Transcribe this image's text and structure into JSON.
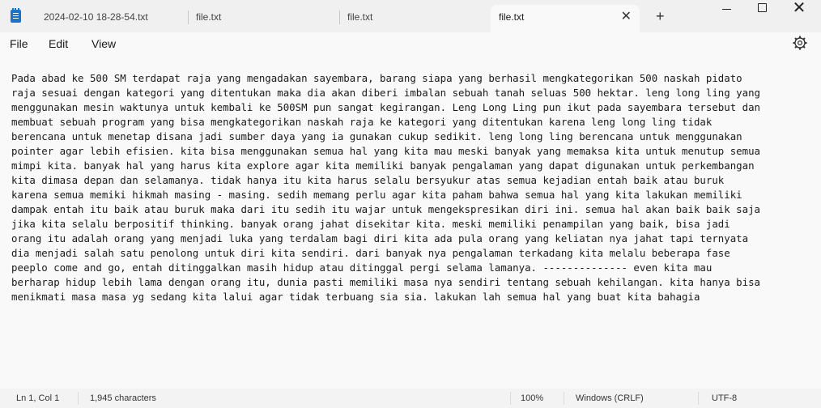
{
  "tabs": [
    {
      "label": "2024-02-10 18-28-54.txt"
    },
    {
      "label": "file.txt"
    },
    {
      "label": "file.txt"
    },
    {
      "label": "file.txt",
      "active": true
    }
  ],
  "window_controls": {
    "close_glyph": "✕",
    "new_tab_glyph": "+"
  },
  "menu": {
    "file": "File",
    "edit": "Edit",
    "view": "View"
  },
  "document": {
    "lines": [
      "Pada abad ke 500 SM terdapat raja yang mengadakan sayembara, barang siapa yang berhasil mengkategorikan 500 naskah pidato",
      "raja sesuai dengan kategori yang ditentukan maka dia akan diberi imbalan sebuah tanah seluas 500 hektar. leng long ling yang",
      "menggunakan mesin waktunya untuk kembali ke 500SM pun sangat kegirangan. Leng Long Ling pun ikut pada sayembara tersebut dan",
      "membuat sebuah program yang bisa mengkategorikan naskah raja ke kategori yang ditentukan karena leng long ling tidak",
      "berencana untuk menetap disana jadi sumber daya yang ia gunakan cukup sedikit. leng long ling berencana untuk menggunakan",
      "pointer agar lebih efisien. kita bisa menggunakan semua hal yang kita mau meski banyak yang memaksa kita untuk menutup semua",
      "mimpi kita. banyak hal yang harus kita explore agar kita memiliki banyak pengalaman yang dapat digunakan untuk perkembangan",
      "kita dimasa depan dan selamanya. tidak hanya itu kita harus selalu bersyukur atas semua kejadian entah baik atau buruk",
      "karena semua memiki hikmah masing - masing. sedih memang perlu agar kita paham bahwa semua hal yang kita lakukan memiliki",
      "dampak entah itu baik atau buruk maka dari itu sedih itu wajar untuk mengekspresikan diri ini. semua hal akan baik baik saja",
      "jika kita selalu berpositif thinking. banyak orang jahat disekitar kita. meski memiliki penampilan yang baik, bisa jadi",
      "orang itu adalah orang yang menjadi luka yang terdalam bagi diri kita ada pula orang yang keliatan nya jahat tapi ternyata",
      "dia menjadi salah satu penolong untuk diri kita sendiri. dari banyak nya pengalaman terkadang kita melalu beberapa fase",
      "peeplo come and go, entah ditinggalkan masih hidup atau ditinggal pergi selama lamanya. -------------- even kita mau",
      "berharap hidup lebih lama dengan orang itu, dunia pasti memiliki masa nya sendiri tentang sebuah kehilangan. kita hanya bisa",
      "menikmati masa masa yg sedang kita lalui agar tidak terbuang sia sia. lakukan lah semua hal yang buat kita bahagia"
    ]
  },
  "status": {
    "position": "Ln 1, Col 1",
    "characters": "1,945 characters",
    "zoom": "100%",
    "line_ending": "Windows (CRLF)",
    "encoding": "UTF-8"
  }
}
